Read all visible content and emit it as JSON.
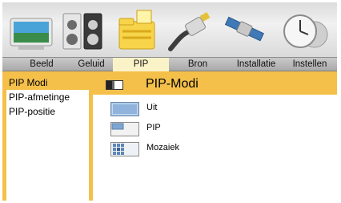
{
  "menu": {
    "icons": [
      "tv-picture-icon",
      "speaker-icon",
      "pip-folder-icon",
      "source-cable-icon",
      "satellite-icon",
      "clock-gear-icon"
    ],
    "tabs": [
      "Beeld",
      "Geluid",
      "PIP",
      "Bron",
      "Installatie",
      "Instellen"
    ],
    "active_tab": "PIP"
  },
  "sidebar": {
    "items": [
      "PIP Modi",
      "PIP-afmetinge",
      "PIP-positie"
    ],
    "active": "PIP Modi"
  },
  "panel": {
    "title": "PIP-Modi",
    "options": [
      "Uit",
      "PIP",
      "Mozaiek"
    ],
    "selected": "Uit"
  },
  "colors": {
    "accent": "#f4c04a",
    "active_tab": "#fbf3c8",
    "tab_bar": "#b9b9b9"
  }
}
